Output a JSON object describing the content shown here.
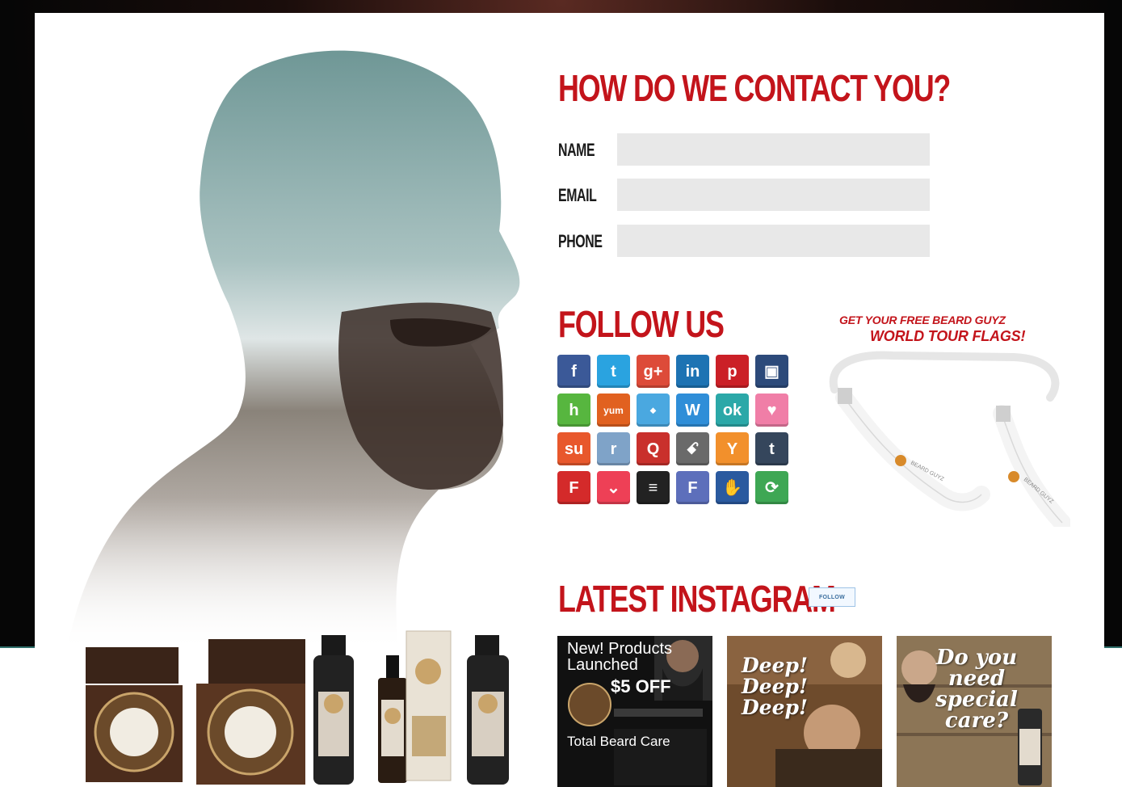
{
  "contact": {
    "heading": "HOW DO WE CONTACT YOU?",
    "fields": [
      {
        "label": "NAME",
        "value": "",
        "placeholder": ""
      },
      {
        "label": "EMAIL",
        "value": "",
        "placeholder": ""
      },
      {
        "label": "PHONE",
        "value": "",
        "placeholder": ""
      }
    ]
  },
  "follow": {
    "heading": "FOLLOW US",
    "icons": [
      {
        "name": "facebook-icon",
        "glyph": "f",
        "color": "#3b5998"
      },
      {
        "name": "twitter-icon",
        "glyph": "t",
        "color": "#2aa3e0"
      },
      {
        "name": "google-plus-icon",
        "glyph": "g+",
        "color": "#dd4b39"
      },
      {
        "name": "linkedin-icon",
        "glyph": "in",
        "color": "#1d73b3"
      },
      {
        "name": "pinterest-icon",
        "glyph": "p",
        "color": "#cb2027"
      },
      {
        "name": "delicious-icon",
        "glyph": "▣",
        "color": "#2c4a7a"
      },
      {
        "name": "houzz-icon",
        "glyph": "h",
        "color": "#57b63f"
      },
      {
        "name": "yummly-icon",
        "glyph": "yum",
        "color": "#e16120"
      },
      {
        "name": "blogger-icon",
        "glyph": "⬩",
        "color": "#4aa8e0"
      },
      {
        "name": "wanelo-icon",
        "glyph": "W",
        "color": "#2f8ed8"
      },
      {
        "name": "ok-icon",
        "glyph": "ok",
        "color": "#2ba8a8"
      },
      {
        "name": "favorite-icon",
        "glyph": "♥",
        "color": "#f07ea7"
      },
      {
        "name": "stumbleupon-icon",
        "glyph": "su",
        "color": "#e8582c"
      },
      {
        "name": "reddit-icon",
        "glyph": "r",
        "color": "#7fa3c8"
      },
      {
        "name": "quora-icon",
        "glyph": "Q",
        "color": "#c9302c"
      },
      {
        "name": "myspace-icon",
        "glyph": "ꗃ",
        "color": "#6a6a6a"
      },
      {
        "name": "ycombinator-icon",
        "glyph": "Y",
        "color": "#f2902c"
      },
      {
        "name": "tumblr-icon",
        "glyph": "t",
        "color": "#35465c"
      },
      {
        "name": "flipboard-icon",
        "glyph": "F",
        "color": "#d42a2a"
      },
      {
        "name": "pocket-icon",
        "glyph": "⌄",
        "color": "#ee4056"
      },
      {
        "name": "buffer-icon",
        "glyph": "≡",
        "color": "#222222"
      },
      {
        "name": "fark-icon",
        "glyph": "F",
        "color": "#5d6fbb"
      },
      {
        "name": "meetup-icon",
        "glyph": "✋",
        "color": "#2a5a9f"
      },
      {
        "name": "sharethis-icon",
        "glyph": "⟳",
        "color": "#3ea754"
      }
    ]
  },
  "promo": {
    "line1": "GET YOUR FREE BEARD GUYZ",
    "line2": "WORLD TOUR FLAGS!"
  },
  "instagram": {
    "heading": "LATEST INSTAGRAM",
    "follow_label": "FOLLOW",
    "posts": [
      {
        "title": "New! Products Launched",
        "offer": "$5 OFF",
        "tagline": "Total Beard Care"
      },
      {
        "title": "Deep! Deep! Deep!"
      },
      {
        "title": "Do you need special care?"
      }
    ]
  },
  "colors": {
    "accent": "#c3141b",
    "input_bg": "#e8e8e8"
  }
}
